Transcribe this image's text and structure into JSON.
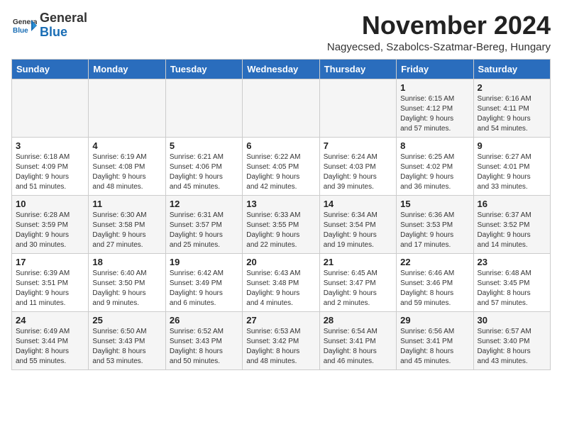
{
  "header": {
    "logo_general": "General",
    "logo_blue": "Blue",
    "month_title": "November 2024",
    "location": "Nagyecsed, Szabolcs-Szatmar-Bereg, Hungary"
  },
  "days_of_week": [
    "Sunday",
    "Monday",
    "Tuesday",
    "Wednesday",
    "Thursday",
    "Friday",
    "Saturday"
  ],
  "weeks": [
    [
      {
        "day": "",
        "info": ""
      },
      {
        "day": "",
        "info": ""
      },
      {
        "day": "",
        "info": ""
      },
      {
        "day": "",
        "info": ""
      },
      {
        "day": "",
        "info": ""
      },
      {
        "day": "1",
        "info": "Sunrise: 6:15 AM\nSunset: 4:12 PM\nDaylight: 9 hours\nand 57 minutes."
      },
      {
        "day": "2",
        "info": "Sunrise: 6:16 AM\nSunset: 4:11 PM\nDaylight: 9 hours\nand 54 minutes."
      }
    ],
    [
      {
        "day": "3",
        "info": "Sunrise: 6:18 AM\nSunset: 4:09 PM\nDaylight: 9 hours\nand 51 minutes."
      },
      {
        "day": "4",
        "info": "Sunrise: 6:19 AM\nSunset: 4:08 PM\nDaylight: 9 hours\nand 48 minutes."
      },
      {
        "day": "5",
        "info": "Sunrise: 6:21 AM\nSunset: 4:06 PM\nDaylight: 9 hours\nand 45 minutes."
      },
      {
        "day": "6",
        "info": "Sunrise: 6:22 AM\nSunset: 4:05 PM\nDaylight: 9 hours\nand 42 minutes."
      },
      {
        "day": "7",
        "info": "Sunrise: 6:24 AM\nSunset: 4:03 PM\nDaylight: 9 hours\nand 39 minutes."
      },
      {
        "day": "8",
        "info": "Sunrise: 6:25 AM\nSunset: 4:02 PM\nDaylight: 9 hours\nand 36 minutes."
      },
      {
        "day": "9",
        "info": "Sunrise: 6:27 AM\nSunset: 4:01 PM\nDaylight: 9 hours\nand 33 minutes."
      }
    ],
    [
      {
        "day": "10",
        "info": "Sunrise: 6:28 AM\nSunset: 3:59 PM\nDaylight: 9 hours\nand 30 minutes."
      },
      {
        "day": "11",
        "info": "Sunrise: 6:30 AM\nSunset: 3:58 PM\nDaylight: 9 hours\nand 27 minutes."
      },
      {
        "day": "12",
        "info": "Sunrise: 6:31 AM\nSunset: 3:57 PM\nDaylight: 9 hours\nand 25 minutes."
      },
      {
        "day": "13",
        "info": "Sunrise: 6:33 AM\nSunset: 3:55 PM\nDaylight: 9 hours\nand 22 minutes."
      },
      {
        "day": "14",
        "info": "Sunrise: 6:34 AM\nSunset: 3:54 PM\nDaylight: 9 hours\nand 19 minutes."
      },
      {
        "day": "15",
        "info": "Sunrise: 6:36 AM\nSunset: 3:53 PM\nDaylight: 9 hours\nand 17 minutes."
      },
      {
        "day": "16",
        "info": "Sunrise: 6:37 AM\nSunset: 3:52 PM\nDaylight: 9 hours\nand 14 minutes."
      }
    ],
    [
      {
        "day": "17",
        "info": "Sunrise: 6:39 AM\nSunset: 3:51 PM\nDaylight: 9 hours\nand 11 minutes."
      },
      {
        "day": "18",
        "info": "Sunrise: 6:40 AM\nSunset: 3:50 PM\nDaylight: 9 hours\nand 9 minutes."
      },
      {
        "day": "19",
        "info": "Sunrise: 6:42 AM\nSunset: 3:49 PM\nDaylight: 9 hours\nand 6 minutes."
      },
      {
        "day": "20",
        "info": "Sunrise: 6:43 AM\nSunset: 3:48 PM\nDaylight: 9 hours\nand 4 minutes."
      },
      {
        "day": "21",
        "info": "Sunrise: 6:45 AM\nSunset: 3:47 PM\nDaylight: 9 hours\nand 2 minutes."
      },
      {
        "day": "22",
        "info": "Sunrise: 6:46 AM\nSunset: 3:46 PM\nDaylight: 8 hours\nand 59 minutes."
      },
      {
        "day": "23",
        "info": "Sunrise: 6:48 AM\nSunset: 3:45 PM\nDaylight: 8 hours\nand 57 minutes."
      }
    ],
    [
      {
        "day": "24",
        "info": "Sunrise: 6:49 AM\nSunset: 3:44 PM\nDaylight: 8 hours\nand 55 minutes."
      },
      {
        "day": "25",
        "info": "Sunrise: 6:50 AM\nSunset: 3:43 PM\nDaylight: 8 hours\nand 53 minutes."
      },
      {
        "day": "26",
        "info": "Sunrise: 6:52 AM\nSunset: 3:43 PM\nDaylight: 8 hours\nand 50 minutes."
      },
      {
        "day": "27",
        "info": "Sunrise: 6:53 AM\nSunset: 3:42 PM\nDaylight: 8 hours\nand 48 minutes."
      },
      {
        "day": "28",
        "info": "Sunrise: 6:54 AM\nSunset: 3:41 PM\nDaylight: 8 hours\nand 46 minutes."
      },
      {
        "day": "29",
        "info": "Sunrise: 6:56 AM\nSunset: 3:41 PM\nDaylight: 8 hours\nand 45 minutes."
      },
      {
        "day": "30",
        "info": "Sunrise: 6:57 AM\nSunset: 3:40 PM\nDaylight: 8 hours\nand 43 minutes."
      }
    ]
  ]
}
